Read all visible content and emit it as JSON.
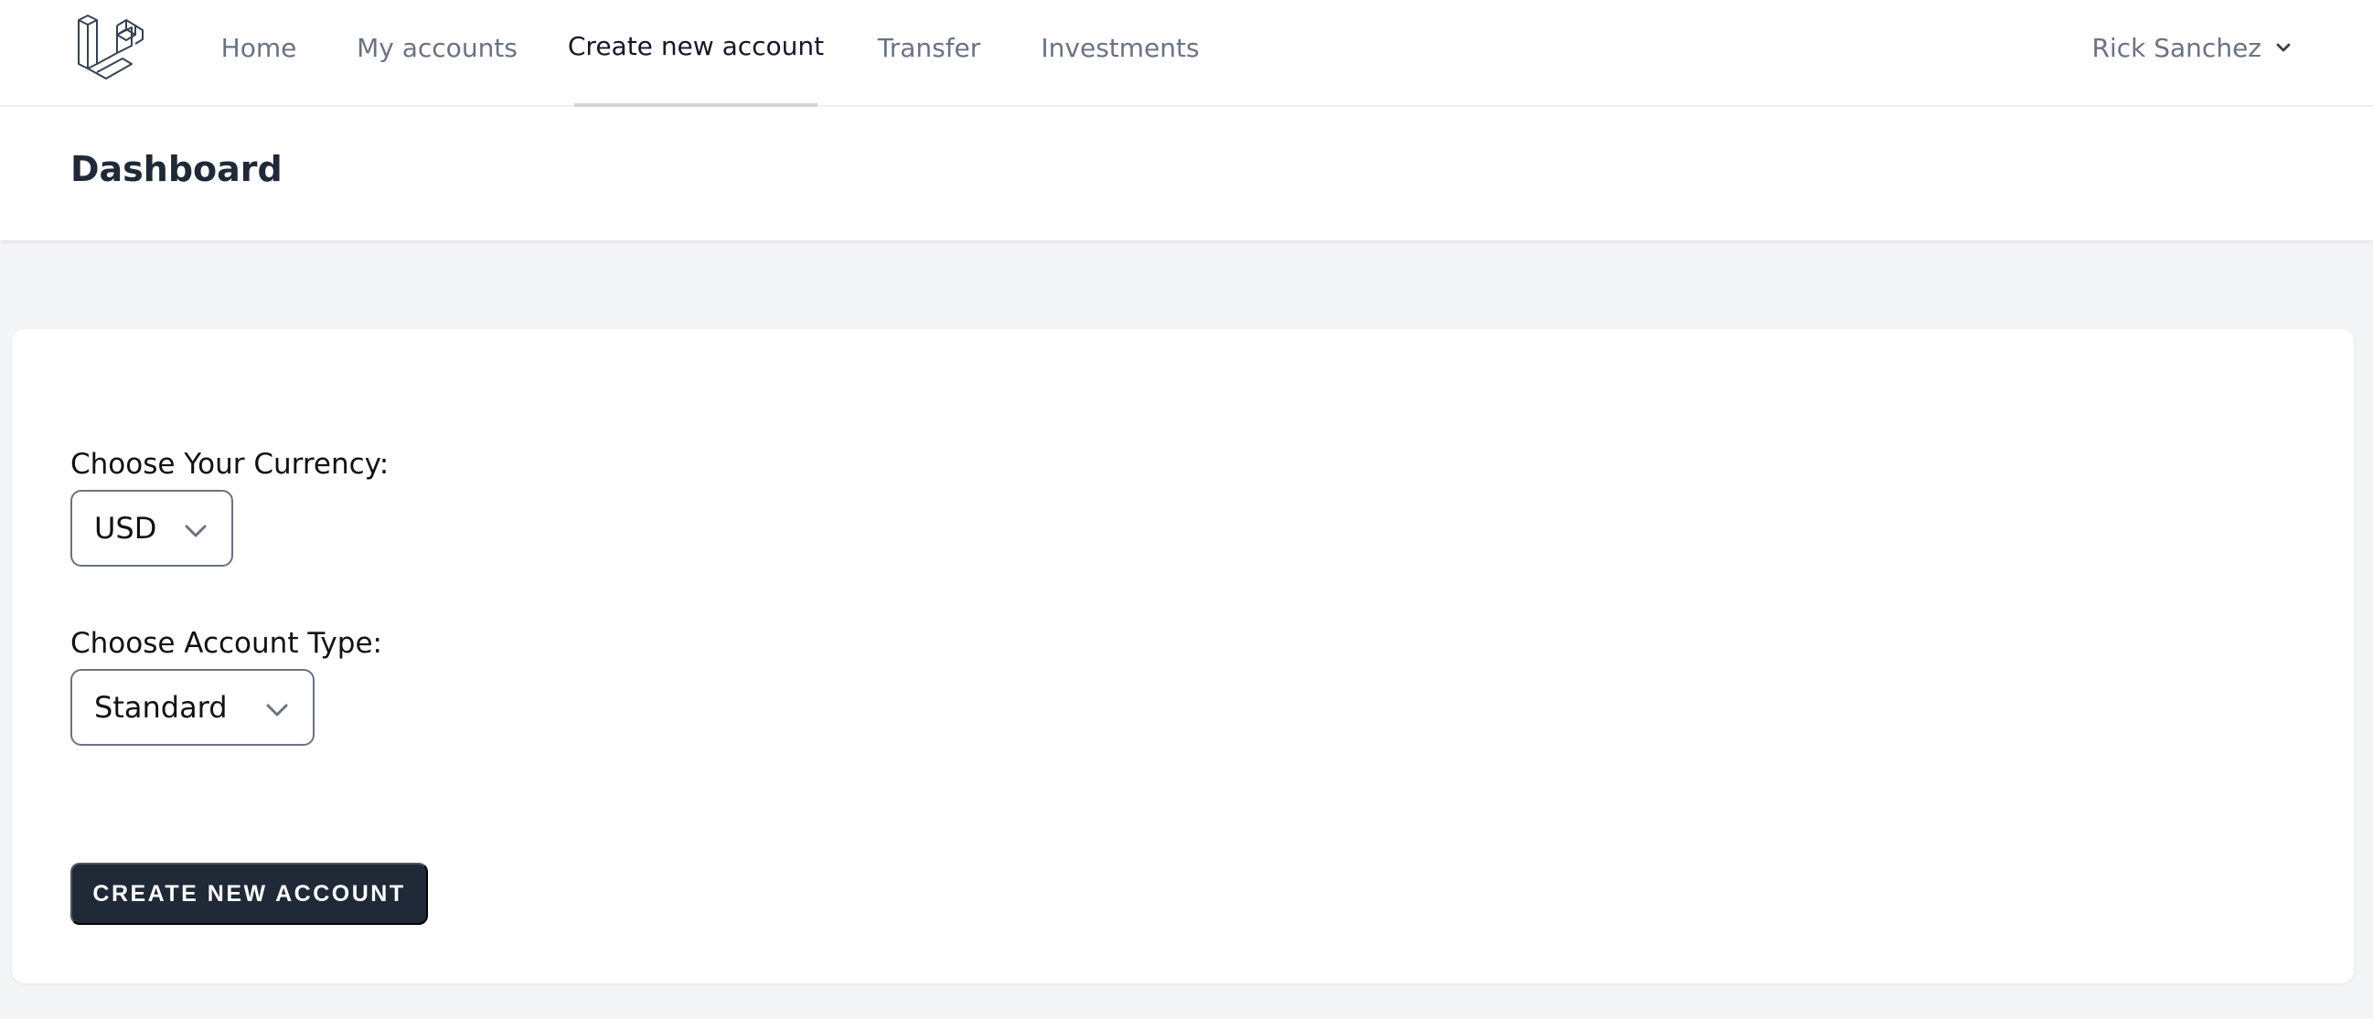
{
  "nav": {
    "items": [
      {
        "label": "Home"
      },
      {
        "label": "My accounts"
      },
      {
        "label": "Create new account"
      },
      {
        "label": "Transfer"
      },
      {
        "label": "Investments"
      }
    ],
    "user_name": "Rick Sanchez"
  },
  "header": {
    "title": "Dashboard"
  },
  "form": {
    "currency_label": "Choose Your Currency:",
    "currency_value": "USD",
    "account_type_label": "Choose Account Type:",
    "account_type_value": "Standard",
    "submit_label": "CREATE NEW ACCOUNT"
  },
  "icons": {
    "logo": "laravel-logo",
    "dropdown": "chevron-down-icon"
  },
  "colors": {
    "background": "#f3f4f6",
    "primary_button": "#1f2937",
    "nav_text": "#6b7280",
    "nav_active_text": "#111827"
  }
}
